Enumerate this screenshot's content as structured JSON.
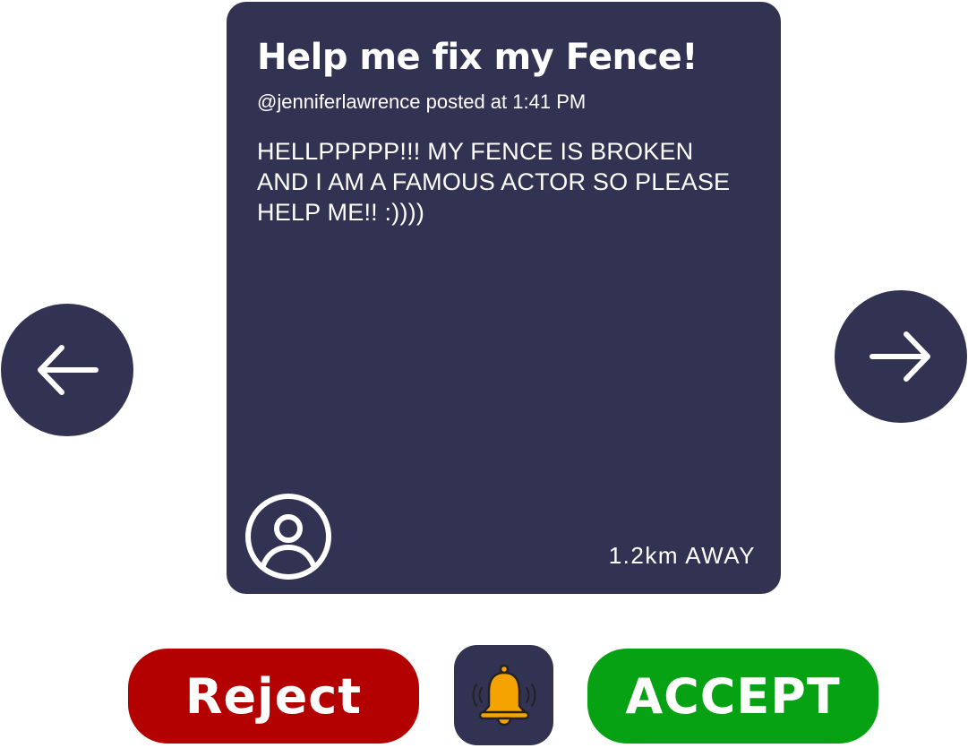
{
  "post": {
    "title": "Help me fix my Fence!",
    "meta": "@jenniferlawrence posted at 1:41 PM",
    "body": "HELLPPPPP!!! MY FENCE IS BROKEN AND I AM A FAMOUS ACTOR SO PLEASE HELP ME!! :))))",
    "distance": "1.2km AWAY",
    "avatar_icon": "user-circle-icon"
  },
  "navigation": {
    "prev_icon": "arrow-left-icon",
    "next_icon": "arrow-right-icon"
  },
  "actions": {
    "reject_label": "Reject",
    "accept_label": "ACCEPT",
    "notify_icon": "bell-icon"
  },
  "colors": {
    "card_background": "#323352",
    "reject": "#b30000",
    "accept": "#06a214",
    "bell": "#f5a300",
    "text": "#ffffff"
  }
}
